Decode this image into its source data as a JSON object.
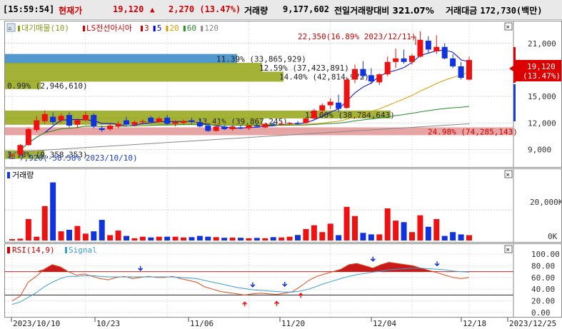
{
  "header": {
    "time": "[15:59:54]",
    "current_label": "현재가",
    "price": "19,120",
    "arrow": "▲",
    "change": "2,270 (13.47%)",
    "volume_label": "거래량",
    "volume": "9,177,602",
    "prev_ratio_label": "전일거래량대비",
    "prev_ratio": "321.07%",
    "amount_label": "거래대금",
    "amount": "172,730(백만)"
  },
  "price_panel": {
    "legend": [
      {
        "text": "대기매물(10)",
        "color": "#8a9a1a"
      },
      {
        "text": "LS전선아시아",
        "color": "#cc0000"
      },
      {
        "text": "3",
        "color": "#cc0000"
      },
      {
        "text": "5",
        "color": "#0000cc"
      },
      {
        "text": "20",
        "color": "#d4a000"
      },
      {
        "text": "60",
        "color": "#2a8a2a"
      },
      {
        "text": "120",
        "color": "#888888"
      }
    ],
    "corner_icon": "home-icon",
    "max_annotation": "22,350(16.89% 2023/12/11)",
    "min_annotation": "7,920(-58.58% 2023/10/10)",
    "last_price": "19,120",
    "last_change": "(13.47%)",
    "y_ticks": [
      "21,000",
      "18,000",
      "15,000",
      "12,000",
      "9,000"
    ],
    "bands": [
      {
        "label": "11.39% (33,865,929)",
        "color": "#3e8ec6"
      },
      {
        "label": "12.59% (37,423,891)",
        "color": "#9aab22"
      },
      {
        "label": "14.40% (42,814,972)",
        "color": "#9aab22"
      },
      {
        "label": "0.99% (2,946,610)",
        "color": "#9aab22"
      },
      {
        "label": "13.00% (38,784,643)",
        "color": "#9aab22"
      },
      {
        "label": "13.41% (39,867,245)",
        "color": "#9aab22"
      },
      {
        "label": "24.98% (74,285,143)",
        "color": "#e39a9a"
      },
      {
        "label": "3.18% (9,358,353)",
        "color": "#9aab22"
      }
    ]
  },
  "volume_panel": {
    "title": "거래량",
    "y_ticks": [
      "20,000K",
      "0K"
    ]
  },
  "rsi_panel": {
    "title": "RSI(14,9)",
    "signal": "Signal",
    "y_ticks": [
      "100.00",
      "80.00",
      "60.00",
      "40.00",
      "20.00",
      "0.00"
    ]
  },
  "x_axis": {
    "labels": [
      "2023/10/10",
      "10/23",
      "11/06",
      "11/20",
      "12/04",
      "12/18",
      "2023/12/25"
    ]
  },
  "chart_data": {
    "type": "candlestick",
    "y_range": [
      7500,
      23000
    ],
    "candles": [
      {
        "o": 8300,
        "h": 8500,
        "l": 7920,
        "c": 8400
      },
      {
        "o": 8400,
        "h": 9600,
        "l": 8300,
        "c": 9500
      },
      {
        "o": 9500,
        "h": 11500,
        "l": 9400,
        "c": 11300
      },
      {
        "o": 11200,
        "h": 12800,
        "l": 11000,
        "c": 12300
      },
      {
        "o": 12200,
        "h": 13400,
        "l": 11900,
        "c": 13000
      },
      {
        "o": 12700,
        "h": 13200,
        "l": 11800,
        "c": 12100
      },
      {
        "o": 12300,
        "h": 13100,
        "l": 12000,
        "c": 12800
      },
      {
        "o": 12900,
        "h": 13200,
        "l": 11500,
        "c": 11700
      },
      {
        "o": 11800,
        "h": 12500,
        "l": 11400,
        "c": 12300
      },
      {
        "o": 12300,
        "h": 13300,
        "l": 12200,
        "c": 12900
      },
      {
        "o": 12900,
        "h": 13100,
        "l": 11400,
        "c": 11600
      },
      {
        "o": 11400,
        "h": 11700,
        "l": 11000,
        "c": 11200
      },
      {
        "o": 11300,
        "h": 11900,
        "l": 11100,
        "c": 11700
      },
      {
        "o": 11600,
        "h": 12200,
        "l": 11400,
        "c": 11900
      },
      {
        "o": 12300,
        "h": 12700,
        "l": 11600,
        "c": 11800
      },
      {
        "o": 11800,
        "h": 12300,
        "l": 11600,
        "c": 12100
      },
      {
        "o": 12100,
        "h": 12400,
        "l": 11800,
        "c": 12200
      },
      {
        "o": 12600,
        "h": 12800,
        "l": 12000,
        "c": 12100
      },
      {
        "o": 12100,
        "h": 12700,
        "l": 12000,
        "c": 12500
      },
      {
        "o": 12600,
        "h": 12900,
        "l": 11800,
        "c": 11900
      },
      {
        "o": 11900,
        "h": 12300,
        "l": 11600,
        "c": 12100
      },
      {
        "o": 12000,
        "h": 12400,
        "l": 11800,
        "c": 12200
      },
      {
        "o": 12300,
        "h": 12600,
        "l": 11900,
        "c": 12100
      },
      {
        "o": 12100,
        "h": 12400,
        "l": 11500,
        "c": 11600
      },
      {
        "o": 11700,
        "h": 12000,
        "l": 11000,
        "c": 11100
      },
      {
        "o": 11100,
        "h": 11800,
        "l": 11000,
        "c": 11600
      },
      {
        "o": 11600,
        "h": 11800,
        "l": 11200,
        "c": 11300
      },
      {
        "o": 11300,
        "h": 11700,
        "l": 11100,
        "c": 11600
      },
      {
        "o": 11500,
        "h": 11800,
        "l": 11300,
        "c": 11400
      },
      {
        "o": 11400,
        "h": 11800,
        "l": 11200,
        "c": 11700
      },
      {
        "o": 11700,
        "h": 11900,
        "l": 11500,
        "c": 11600
      },
      {
        "o": 11500,
        "h": 12000,
        "l": 11400,
        "c": 11900
      },
      {
        "o": 11900,
        "h": 12100,
        "l": 11700,
        "c": 11800
      },
      {
        "o": 11800,
        "h": 12200,
        "l": 11700,
        "c": 11900
      },
      {
        "o": 11900,
        "h": 12100,
        "l": 11800,
        "c": 12000
      },
      {
        "o": 12000,
        "h": 12200,
        "l": 11800,
        "c": 11900
      },
      {
        "o": 12000,
        "h": 12600,
        "l": 11900,
        "c": 12500
      },
      {
        "o": 12500,
        "h": 13600,
        "l": 12400,
        "c": 13400
      },
      {
        "o": 13400,
        "h": 14200,
        "l": 13000,
        "c": 14000
      },
      {
        "o": 14000,
        "h": 14800,
        "l": 13600,
        "c": 14400
      },
      {
        "o": 14300,
        "h": 15200,
        "l": 13200,
        "c": 13600
      },
      {
        "o": 13700,
        "h": 17200,
        "l": 13600,
        "c": 16900
      },
      {
        "o": 16900,
        "h": 18600,
        "l": 16500,
        "c": 18100
      },
      {
        "o": 18100,
        "h": 19000,
        "l": 17000,
        "c": 17300
      },
      {
        "o": 17400,
        "h": 18200,
        "l": 16400,
        "c": 16700
      },
      {
        "o": 16600,
        "h": 17600,
        "l": 16300,
        "c": 17500
      },
      {
        "o": 17500,
        "h": 19500,
        "l": 17300,
        "c": 18900
      },
      {
        "o": 18900,
        "h": 20400,
        "l": 18200,
        "c": 19300
      },
      {
        "o": 19300,
        "h": 20300,
        "l": 18700,
        "c": 18900
      },
      {
        "o": 18900,
        "h": 19800,
        "l": 18600,
        "c": 19600
      },
      {
        "o": 19500,
        "h": 22350,
        "l": 19400,
        "c": 21400
      },
      {
        "o": 21300,
        "h": 21800,
        "l": 19900,
        "c": 20300
      },
      {
        "o": 20100,
        "h": 21900,
        "l": 19800,
        "c": 20600
      },
      {
        "o": 20600,
        "h": 21000,
        "l": 19200,
        "c": 19300
      },
      {
        "o": 19300,
        "h": 19800,
        "l": 18200,
        "c": 18400
      },
      {
        "o": 18400,
        "h": 18900,
        "l": 16900,
        "c": 17100
      },
      {
        "o": 16900,
        "h": 19500,
        "l": 16800,
        "c": 19120
      }
    ],
    "volume_k": [
      900,
      1200,
      14000,
      2500,
      22500,
      38000,
      6000,
      7000,
      9500,
      4500,
      6000,
      13500,
      3500,
      6500,
      3000,
      1500,
      2500,
      2000,
      2500,
      2500,
      2500,
      2000,
      2200,
      3000,
      2500,
      2200,
      1800,
      1900,
      1800,
      1500,
      1700,
      1500,
      2200,
      2000,
      2500,
      3600,
      7500,
      10000,
      5500,
      11000,
      3500,
      22000,
      16000,
      5000,
      4000,
      4000,
      21000,
      13000,
      12000,
      5500,
      16500,
      9000,
      14000,
      3000,
      5500,
      4000,
      3500,
      3500,
      10000
    ],
    "rsi": [
      20,
      28,
      52,
      62,
      74,
      82,
      78,
      70,
      64,
      66,
      62,
      58,
      56,
      60,
      62,
      58,
      60,
      62,
      60,
      60,
      62,
      58,
      55,
      52,
      44,
      40,
      36,
      34,
      32,
      30,
      32,
      33,
      32,
      31,
      33,
      36,
      45,
      55,
      62,
      66,
      70,
      74,
      82,
      84,
      80,
      76,
      82,
      86,
      84,
      82,
      80,
      76,
      72,
      68,
      64,
      60,
      58,
      60
    ],
    "signal": [
      14,
      18,
      26,
      34,
      44,
      52,
      58,
      62,
      62,
      63,
      63,
      62,
      61,
      61,
      61,
      61,
      61,
      61,
      61,
      61,
      61,
      60,
      59,
      58,
      55,
      52,
      49,
      46,
      43,
      41,
      39,
      38,
      37,
      36,
      35,
      35,
      37,
      40,
      45,
      50,
      54,
      58,
      62,
      65,
      67,
      69,
      71,
      73,
      74,
      75,
      76,
      76,
      75,
      74,
      73,
      71,
      70,
      69
    ]
  }
}
